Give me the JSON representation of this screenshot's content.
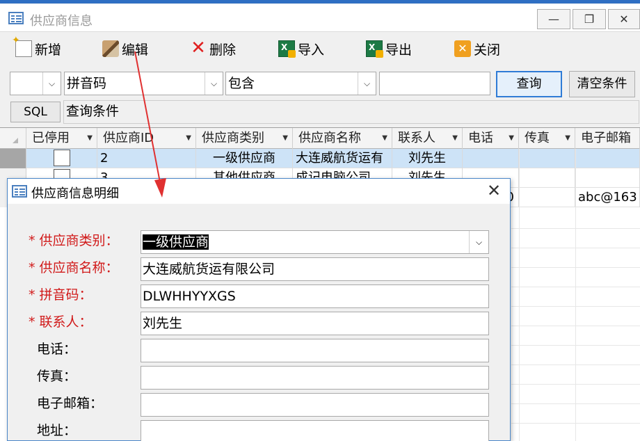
{
  "window": {
    "title": "供应商信息"
  },
  "toolbar": {
    "new_label": "新增",
    "edit_label": "编辑",
    "delete_label": "删除",
    "import_label": "导入",
    "export_label": "导出",
    "close_label": "关闭"
  },
  "filter": {
    "field_value": "拼音码",
    "operator_value": "包含",
    "keyword_value": "",
    "query_label": "查询",
    "clear_label": "清空条件",
    "sql_label": "SQL",
    "condition_text": "查询条件"
  },
  "grid": {
    "columns": [
      "已停用",
      "供应商ID",
      "供应商类别",
      "供应商名称",
      "联系人",
      "电话",
      "传真",
      "电子邮箱"
    ],
    "rows": [
      {
        "id": "2",
        "category": "一级供应商",
        "name": "大连威航货运有",
        "contact": "刘先生",
        "phone": "",
        "fax": "",
        "email": ""
      },
      {
        "id": "3",
        "category": "其他供应商",
        "name": "成记电脑公司",
        "contact": "刘先生",
        "phone": "",
        "fax": "",
        "email": ""
      },
      {
        "id": "",
        "category": "",
        "name": "",
        "contact": "",
        "phone": "0",
        "fax": "",
        "email": "abc@163"
      }
    ]
  },
  "dialog": {
    "title": "供应商信息明细",
    "labels": {
      "category": "* 供应商类别：",
      "name": "* 供应商名称：",
      "pinyin": "* 拼音码：",
      "contact": "* 联系人：",
      "phone": "电话：",
      "fax": "传真：",
      "email": "电子邮箱：",
      "address": "地址："
    },
    "values": {
      "category": "一级供应商",
      "name": "大连威航货运有限公司",
      "pinyin": "DLWHHYYXGS",
      "contact": "刘先生",
      "phone": "",
      "fax": "",
      "email": "",
      "address": ""
    }
  },
  "icons": {
    "window": "form-icon",
    "new": "new-document-icon",
    "edit": "edit-icon",
    "delete": "delete-x-icon",
    "import": "excel-import-icon",
    "export": "excel-export-icon",
    "close": "close-box-icon"
  },
  "colors": {
    "required_label": "#d11a1a",
    "selected_row": "#cde3f7",
    "annotation_arrow": "#e03030"
  }
}
